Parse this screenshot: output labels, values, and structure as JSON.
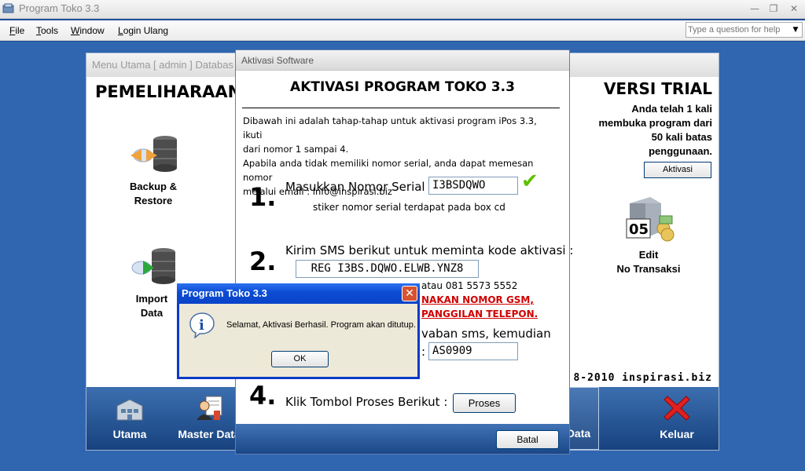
{
  "app": {
    "title": "Program Toko 3.3",
    "minimize": "—",
    "restore": "❐",
    "close": "✕"
  },
  "menubar": {
    "items": [
      {
        "underline": "F",
        "rest": "ile"
      },
      {
        "underline": "T",
        "rest": "ools"
      },
      {
        "underline": "W",
        "rest": "indow"
      },
      {
        "underline": "L",
        "rest": "ogin Ulang"
      }
    ],
    "help_placeholder": "Type a question for help",
    "help_arrow": "▼"
  },
  "main_window": {
    "title": "Menu Utama [ admin ] Databas",
    "heading": "PEMELIHARAAN D",
    "version_heading": "VERSI TRIAL",
    "trial_line1": "Anda telah 1 kali",
    "trial_line2": "membuka program dari",
    "trial_line3": "50 kali batas",
    "trial_line4": "penggunaan.",
    "aktivasi_button": "Aktivasi",
    "tools": {
      "backup_line1": "Backup &",
      "backup_line2": "Restore",
      "import_line1": "Import",
      "import_line2": "Data",
      "edit_line1": "Edit",
      "edit_line2": "No Transaksi",
      "edit_badge": "05"
    },
    "copyright": "8-2010 inspirasi.biz",
    "nav": {
      "utama": "Utama",
      "master": "Master Data",
      "data": "Data",
      "keluar": "Keluar"
    }
  },
  "activation": {
    "window_title": "Aktivasi Software",
    "heading": "AKTIVASI PROGRAM TOKO 3.3",
    "intro_line1": "Dibawah ini adalah tahap-tahap untuk aktivasi program iPos 3.3, ikuti",
    "intro_line2": "dari nomor 1 sampai 4.",
    "intro_line3": "Apabila anda tidak memiliki nomor serial, anda dapat memesan nomor",
    "intro_line4": "melalui email : info@inspirasi.biz",
    "step1_num": "1.",
    "step1_label": "Masukkan Nomor Serial :",
    "serial_value": "I3BSDQWO",
    "check_mark": "✔",
    "step1_note": "stiker nomor serial terdapat pada box cd",
    "step2_num": "2.",
    "step2_label": "Kirim SMS berikut untuk meminta kode aktivasi :",
    "sms_value": "REG I3BS.DQWO.ELWB.YNZ8",
    "step2_phone": "atau 081 5573 5552",
    "step2_warn1": "NAKAN NOMOR GSM,",
    "step2_warn2": "PANGGILAN TELEPON.",
    "step3_text": "vaban sms, kemudian",
    "step3_colon": ":",
    "code_value": "AS0909",
    "step4_num": "4.",
    "step4_label": "Klik Tombol Proses Berikut :",
    "proses_button": "Proses",
    "batal_button": "Batal"
  },
  "message_box": {
    "title": "Program Toko 3.3",
    "message": "Selamat, Aktivasi Berhasil. Program akan ditutup.",
    "ok_button": "OK",
    "close": "✕",
    "info_glyph": "i"
  },
  "colors": {
    "xp_title_blue": "#0a44c8",
    "warning_red": "#d00000",
    "nav_bar": "#2a5da0",
    "check_green": "#5fc000"
  }
}
